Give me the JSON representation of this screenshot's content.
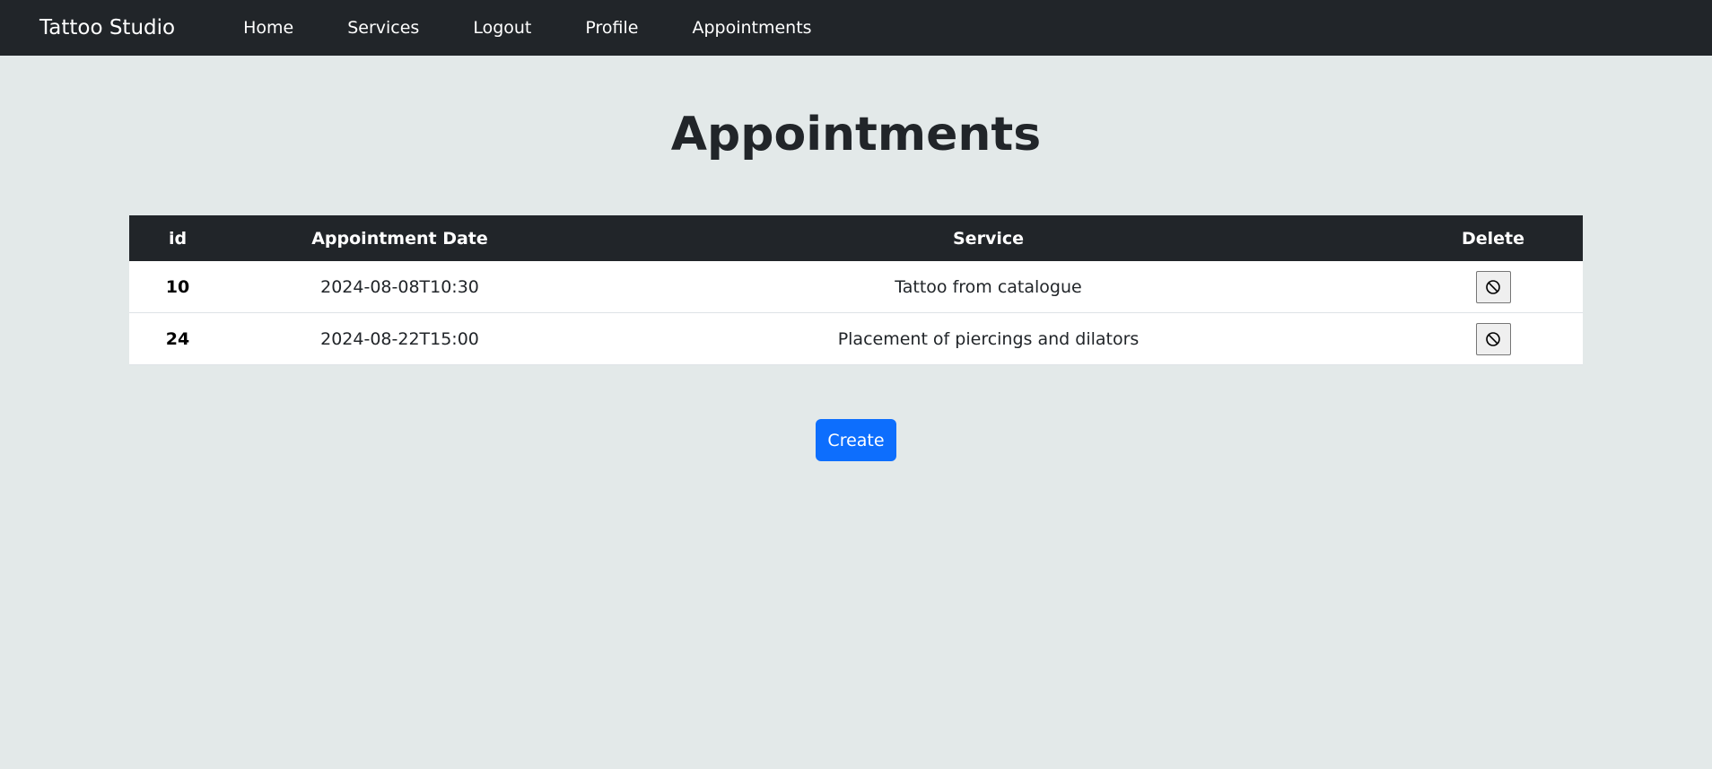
{
  "nav": {
    "brand": "Tattoo Studio",
    "links": [
      "Home",
      "Services",
      "Logout",
      "Profile",
      "Appointments"
    ]
  },
  "page": {
    "title": "Appointments"
  },
  "table": {
    "headers": [
      "id",
      "Appointment Date",
      "Service",
      "Delete"
    ],
    "rows": [
      {
        "id": "10",
        "date": "2024-08-08T10:30",
        "service": "Tattoo from catalogue"
      },
      {
        "id": "24",
        "date": "2024-08-22T15:00",
        "service": "Placement of piercings and dilators"
      }
    ]
  },
  "actions": {
    "create_label": "Create",
    "delete_icon": "ban-icon"
  },
  "colors": {
    "navbar": "#212529",
    "background": "#e3e9e9",
    "primary": "#0d6efd"
  }
}
